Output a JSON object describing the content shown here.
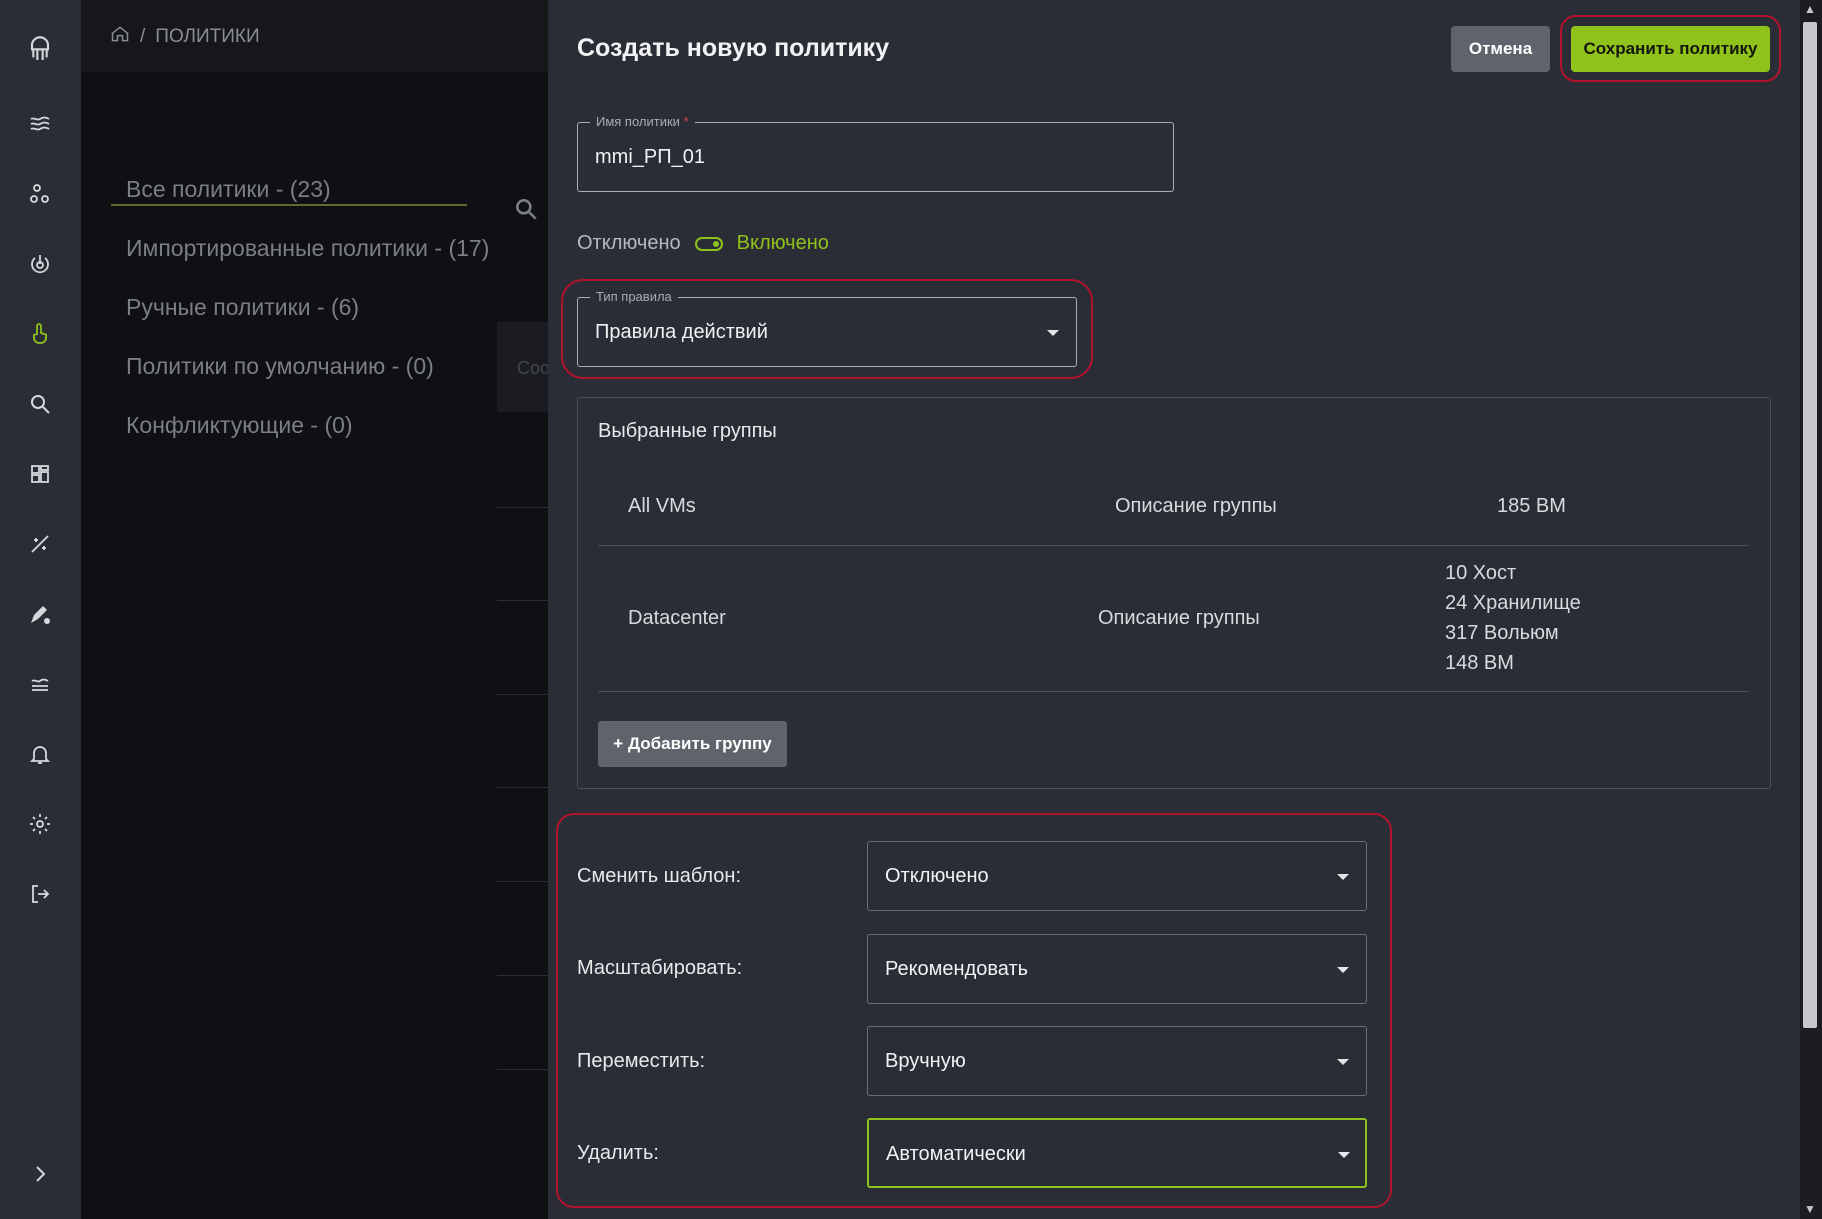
{
  "breadcrumb": {
    "page": "ПОЛИТИКИ"
  },
  "categories": [
    {
      "label": "Все политики - (23)"
    },
    {
      "label": "Импортированные политики - (17)"
    },
    {
      "label": "Ручные политики - (6)"
    },
    {
      "label": "Политики по умолчанию - (0)"
    },
    {
      "label": "Конфликтующие - (0)"
    }
  ],
  "background": {
    "table_fragment": "Соо"
  },
  "drawer": {
    "title": "Создать новую политику",
    "cancel_label": "Отмена",
    "save_label": "Сохранить политику",
    "name_field": {
      "legend": "Имя политики",
      "required_mark": "*",
      "value": "mmi_РП_01"
    },
    "status": {
      "off_label": "Отключено",
      "on_label": "Включено",
      "enabled": true
    },
    "rule_type": {
      "legend": "Тип правила",
      "value": "Правила действий"
    },
    "groups": {
      "title": "Выбранные группы",
      "rows": [
        {
          "name": "All VMs",
          "description": "Описание группы",
          "stats": [
            "185 ВМ"
          ]
        },
        {
          "name": "Datacenter",
          "description": "Описание группы",
          "stats": [
            "10 Хост",
            "24 Хранилище",
            "317 Вольюм",
            "148 ВМ"
          ]
        }
      ],
      "add_label": "+ Добавить группу"
    },
    "actions": [
      {
        "label": "Сменить шаблон:",
        "value": "Отключено"
      },
      {
        "label": "Масштабировать:",
        "value": "Рекомендовать"
      },
      {
        "label": "Переместить:",
        "value": "Вручную"
      },
      {
        "label": "Удалить:",
        "value": "Автоматически"
      }
    ]
  },
  "colors": {
    "accent": "#8fc21a",
    "highlight": "#b3122c",
    "panel": "#2a2d35",
    "background": "#0f1013"
  },
  "icons": [
    "logo-octopus-icon",
    "waves-icon",
    "nodes-icon",
    "power-icon",
    "hand-pointer-icon",
    "search-icon",
    "dashboard-icon",
    "sparkle-icon",
    "pen-gear-icon",
    "layers-icon",
    "bell-icon",
    "gear-icon",
    "logout-icon",
    "chevron-right-icon",
    "home-icon"
  ]
}
